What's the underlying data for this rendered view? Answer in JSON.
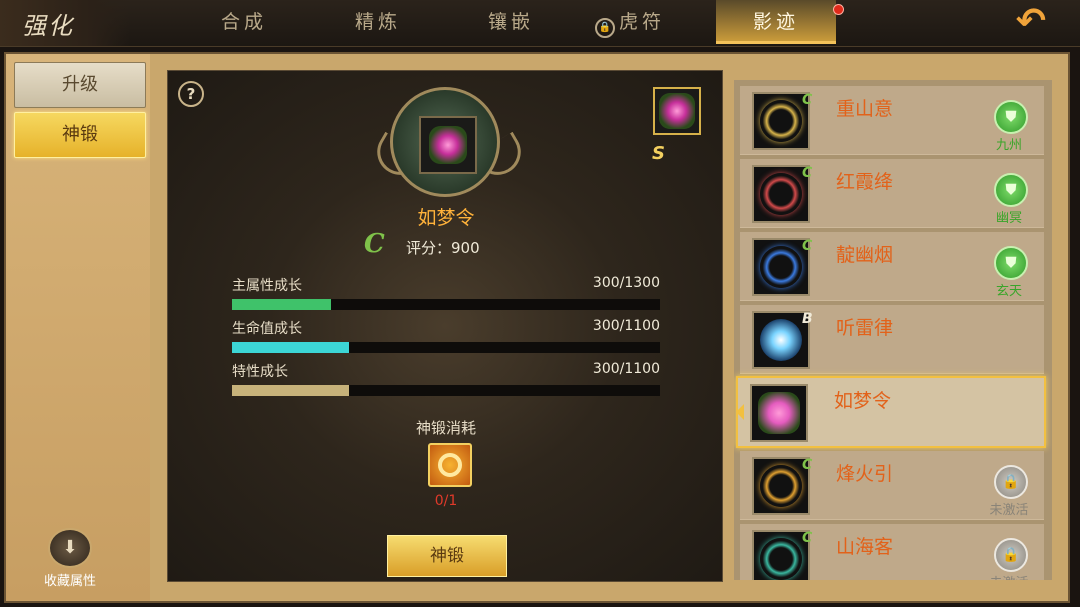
{
  "header": {
    "title": "强化",
    "tabs": [
      {
        "label": "合成",
        "active": false
      },
      {
        "label": "精炼",
        "active": false
      },
      {
        "label": "镶嵌",
        "active": false
      },
      {
        "label": "虎符",
        "active": false,
        "locked": true
      },
      {
        "label": "影迹",
        "active": true,
        "notification": true
      }
    ],
    "back_icon": "back-arrow-icon"
  },
  "sidebar": {
    "items": [
      {
        "label": "升级",
        "active": false
      },
      {
        "label": "神锻",
        "active": true
      }
    ],
    "collect_label": "收藏属性"
  },
  "detail": {
    "help_icon": "?",
    "item_name": "如梦令",
    "grade": "C",
    "mini_grade": "S",
    "score_text": "评分：900",
    "stats": [
      {
        "label": "主属性成长",
        "value_text": "300/1300",
        "current": 300,
        "max": 1300,
        "color": "#3fc26a"
      },
      {
        "label": "生命值成长",
        "value_text": "300/1100",
        "current": 300,
        "max": 1100,
        "color": "#3cd6d6"
      },
      {
        "label": "特性成长",
        "value_text": "300/1100",
        "current": 300,
        "max": 1100,
        "color": "#c7b27a"
      }
    ],
    "cost_label": "神锻消耗",
    "cost_count": "0/1",
    "forge_button": "神锻"
  },
  "list": {
    "items": [
      {
        "name": "重山意",
        "grade": "C",
        "icon": "gold-ring-swirl-icon",
        "status": "active",
        "badge_label": "九州",
        "color": "#d7b34a"
      },
      {
        "name": "红霞绛",
        "grade": "C",
        "icon": "red-ring-swirl-icon",
        "status": "active",
        "badge_label": "幽冥",
        "color": "#d24a4a"
      },
      {
        "name": "靛幽烟",
        "grade": "C",
        "icon": "blue-ring-swirl-icon",
        "status": "active",
        "badge_label": "玄天",
        "color": "#3a7ae0"
      },
      {
        "name": "听雷律",
        "grade": "B",
        "icon": "lightning-orb-icon",
        "status": "none",
        "badge_label": "",
        "color": "#7ad4ff"
      },
      {
        "name": "如梦令",
        "grade": "",
        "icon": "pink-flower-icon",
        "status": "selected",
        "badge_label": "",
        "color": "#e55cbf"
      },
      {
        "name": "烽火引",
        "grade": "C",
        "icon": "fire-swirl-icon",
        "status": "locked",
        "badge_label": "未激活",
        "color": "#e0a030"
      },
      {
        "name": "山海客",
        "grade": "C",
        "icon": "jade-swirl-icon",
        "status": "locked",
        "badge_label": "未激活",
        "color": "#3ab8a0"
      }
    ]
  }
}
